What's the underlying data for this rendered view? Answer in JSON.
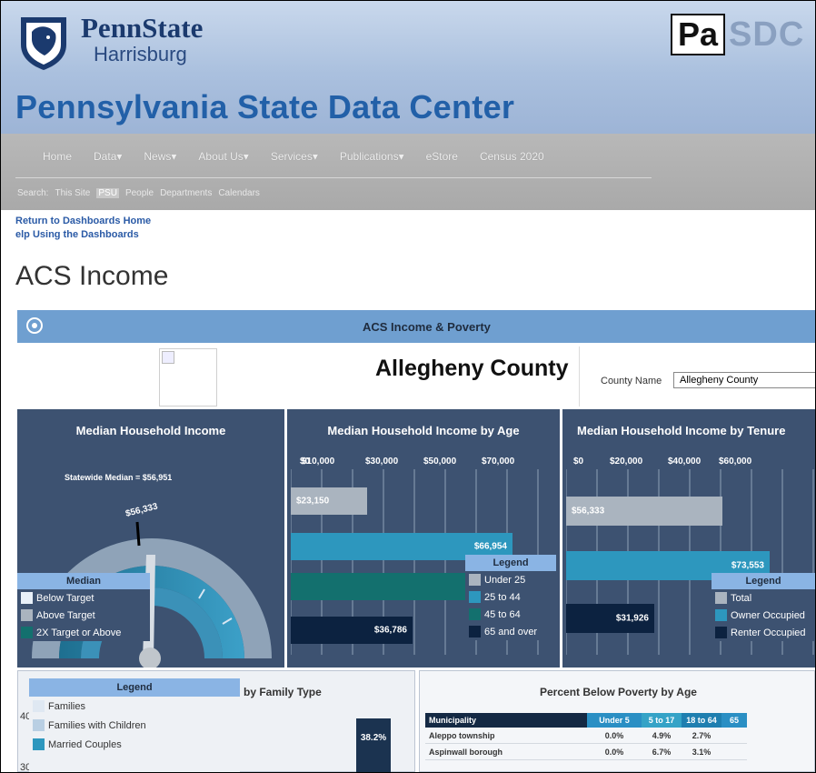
{
  "header": {
    "university_name": "PennState",
    "campus": "Harrisburg",
    "brand_left": "Pa",
    "brand_right": "SDC",
    "site_title": "Pennsylvania State Data Center"
  },
  "nav": {
    "menu": [
      "Home",
      "Data▾",
      "News▾",
      "About Us▾",
      "Services▾",
      "Publications▾",
      "eStore",
      "Census 2020"
    ],
    "search_label": "Search:",
    "search_scopes": [
      "This Site",
      "PSU",
      "People",
      "Departments",
      "Calendars"
    ]
  },
  "links": {
    "return_home": "Return to Dashboards Home",
    "help": "elp Using the Dashboards"
  },
  "page": {
    "title": "ACS Income"
  },
  "dashboard": {
    "title": "ACS Income & Poverty",
    "county_heading": "Allegheny County",
    "county_label": "County Name",
    "county_value": "Allegheny County"
  },
  "median_income": {
    "title": "Median Household Income",
    "statewide_label": "Statewide Median = $56,951",
    "value_label": "$56,333",
    "value": 56333,
    "legend_title": "Median",
    "legend": [
      "Below Target",
      "Above Target",
      "2X Target or Above"
    ]
  },
  "by_age": {
    "title": "Median Household Income by Age",
    "ticks": [
      "$10,000",
      "$30,000",
      "$50,000",
      "$70,000"
    ],
    "tick_overlap": "$0",
    "bars": [
      {
        "name": "Under 25",
        "label": "$23,150",
        "value": 23150,
        "color": "#aab4bf"
      },
      {
        "name": "25 to 44",
        "label": "$66,954",
        "value": 66954,
        "color": "#2d97be"
      },
      {
        "name": "45 to 64",
        "label": "",
        "value": 76000,
        "color": "#13706e"
      },
      {
        "name": "65 and over",
        "label": "$36,786",
        "value": 36786,
        "color": "#0c2240"
      }
    ],
    "legend_title": "Legend",
    "legend": [
      "Under 25",
      "25 to 44",
      "45 to 64",
      "65 and over"
    ]
  },
  "by_tenure": {
    "title": "Median Household Income by Tenure",
    "ticks": [
      "$0",
      "$20,000",
      "$40,000",
      "$60,000"
    ],
    "bars": [
      {
        "name": "Total",
        "label": "$56,333",
        "value": 56333,
        "color": "#aab4bf"
      },
      {
        "name": "Owner Occupied",
        "label": "$73,553",
        "value": 73553,
        "color": "#2d97be"
      },
      {
        "name": "Renter Occupied",
        "label": "$31,926",
        "value": 31926,
        "color": "#0c2240"
      }
    ],
    "legend_title": "Legend",
    "legend": [
      "Total",
      "Owner Occupied",
      "Renter Occupied"
    ]
  },
  "family_type": {
    "title_fragment": "by Family Type",
    "legend_title": "Legend",
    "legend": [
      "Families",
      "Families with Children",
      "Married Couples"
    ],
    "y_ticks": [
      "40",
      "30"
    ],
    "bar_label": "38.2%"
  },
  "poverty_age": {
    "title": "Percent Below Poverty by Age",
    "columns": [
      "Municipality",
      "Under 5",
      "5 to 17",
      "18 to 64",
      "65"
    ],
    "rows": [
      [
        "Aleppo township",
        "0.0%",
        "4.9%",
        "2.7%"
      ],
      [
        "Aspinwall borough",
        "0.0%",
        "6.7%",
        "3.1%"
      ]
    ]
  },
  "colors": {
    "panel_bg": "#3d5271",
    "dash_bar": "#6f9fd0",
    "legend_head": "#8ab4e4",
    "title_blue": "#2260a8"
  }
}
